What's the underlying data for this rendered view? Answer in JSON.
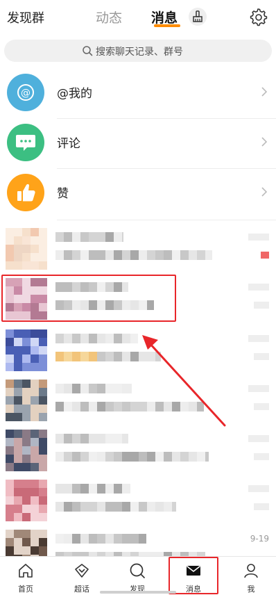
{
  "topbar": {
    "left_link": "发现群",
    "tabs": [
      {
        "label": "动态",
        "active": false
      },
      {
        "label": "消息",
        "active": true
      }
    ],
    "accent_color": "#FF8C00",
    "broom_icon": "broom-icon",
    "settings_icon": "gear-icon"
  },
  "search": {
    "placeholder": "搜索聊天记录、群号"
  },
  "functions": [
    {
      "label": "@我的",
      "icon": "at-icon",
      "color": "#4FB0DC"
    },
    {
      "label": "评论",
      "icon": "comment-icon",
      "color": "#3CBF82"
    },
    {
      "label": "赞",
      "icon": "thumbs-up-icon",
      "color": "#FFA319"
    }
  ],
  "chats": [
    {
      "time": ""
    },
    {
      "time": ""
    },
    {
      "time": ""
    },
    {
      "time": ""
    },
    {
      "time": ""
    },
    {
      "time": ""
    },
    {
      "time": "9-19"
    }
  ],
  "annotation_color": "#E8262A",
  "bottom_nav": {
    "items": [
      {
        "label": "首页",
        "icon": "home-icon",
        "active": false
      },
      {
        "label": "超话",
        "icon": "diamond-icon",
        "active": false
      },
      {
        "label": "发现",
        "icon": "discover-icon",
        "active": false
      },
      {
        "label": "消息",
        "icon": "mail-icon",
        "active": true
      },
      {
        "label": "我",
        "icon": "profile-icon",
        "active": false
      }
    ]
  }
}
